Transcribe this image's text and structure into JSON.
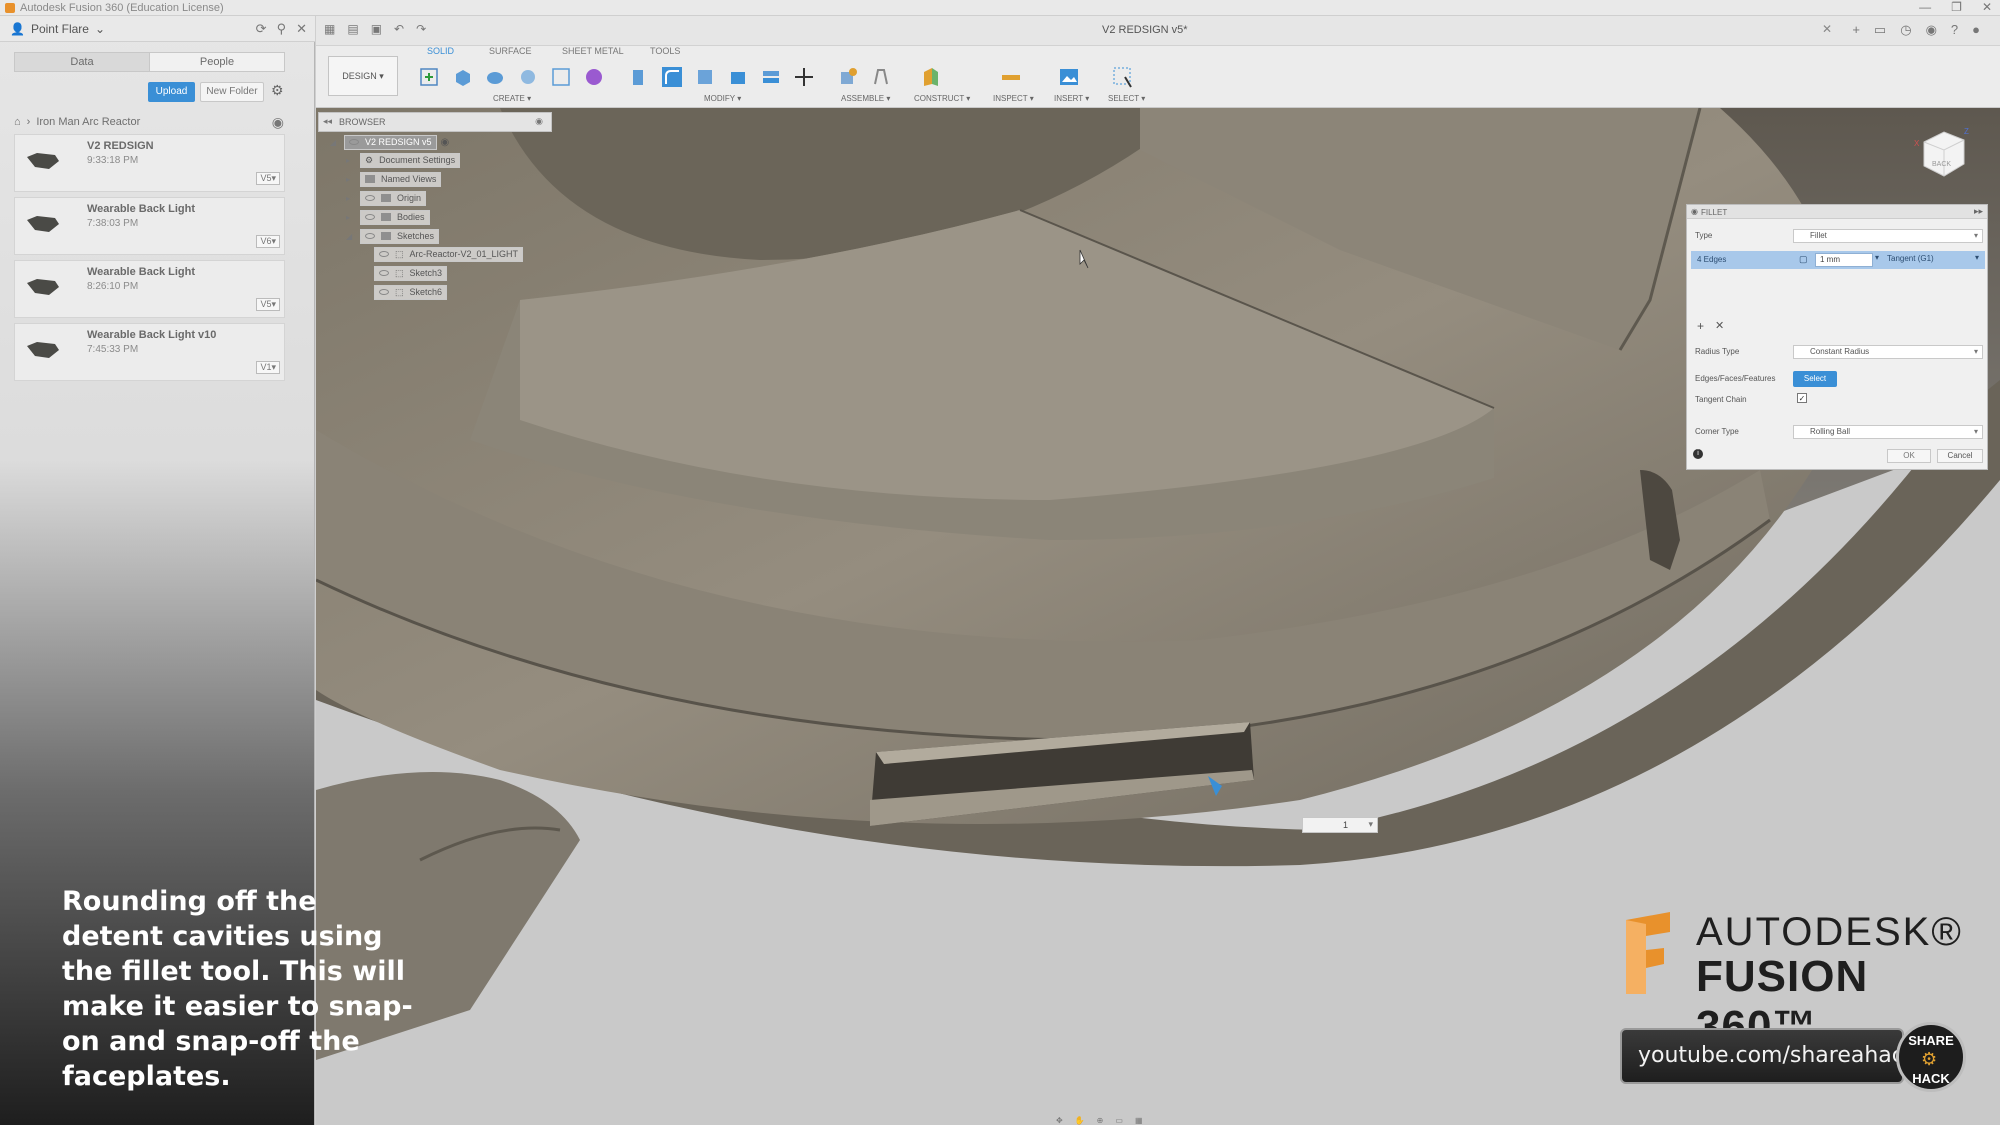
{
  "window": {
    "title": "Autodesk Fusion 360 (Education License)",
    "controls": [
      "—",
      "❐",
      "✕"
    ]
  },
  "data_panel": {
    "user": "Point Flare",
    "tabs": [
      {
        "label": "Data",
        "active": true
      },
      {
        "label": "People",
        "active": false
      }
    ],
    "upload_label": "Upload",
    "new_folder_label": "New Folder",
    "breadcrumb": "Iron Man Arc Reactor",
    "files": [
      {
        "name": "V2 REDSIGN",
        "time": "9:33:18 PM",
        "version": "V5▾"
      },
      {
        "name": "Wearable Back Light",
        "time": "7:38:03 PM",
        "version": "V6▾"
      },
      {
        "name": "Wearable Back Light",
        "time": "8:26:10 PM",
        "version": "V5▾"
      },
      {
        "name": "Wearable Back Light v10",
        "time": "7:45:33 PM",
        "version": "V1▾"
      }
    ]
  },
  "toolbar": {
    "doc_title": "V2 REDSIGN v5*",
    "workspace": "DESIGN ▾",
    "tabs": [
      {
        "label": "SOLID",
        "active": true
      },
      {
        "label": "SURFACE",
        "active": false
      },
      {
        "label": "SHEET METAL",
        "active": false
      },
      {
        "label": "TOOLS",
        "active": false
      }
    ],
    "groups": [
      "CREATE ▾",
      "MODIFY ▾",
      "ASSEMBLE ▾",
      "CONSTRUCT ▾",
      "INSPECT ▾",
      "INSERT ▾",
      "SELECT ▾"
    ]
  },
  "browser": {
    "title": "BROWSER",
    "root": "V2 REDSIGN v5",
    "nodes": [
      "Document Settings",
      "Named Views",
      "Origin",
      "Bodies",
      "Sketches"
    ],
    "sketches": [
      "Arc-Reactor-V2_01_LIGHT",
      "Sketch3",
      "Sketch6"
    ]
  },
  "viewcube": {
    "label": "BACK"
  },
  "fillet": {
    "title": "FILLET",
    "type_label": "Type",
    "type_value": "Fillet",
    "selection_label": "4 Edges",
    "radius_value": "1 mm",
    "continuity": "Tangent (G1)",
    "radius_type_label": "Radius Type",
    "radius_type_value": "Constant Radius",
    "edges_label": "Edges/Faces/Features",
    "select_label": "Select",
    "tangent_chain_label": "Tangent Chain",
    "tangent_chain_checked": true,
    "corner_type_label": "Corner Type",
    "corner_type_value": "Rolling Ball",
    "ok_label": "OK",
    "cancel_label": "Cancel"
  },
  "canvas_input": {
    "value": "1",
    "dropdown": "▾"
  },
  "caption": "Rounding off the detent cavities using the fillet tool. This will make it easier to snap-on and snap-off the faceplates.",
  "brand": {
    "line1": "AUTODESK®",
    "line2": "FUSION 360™",
    "youtube": "youtube.com/shareahack",
    "badge_top": "SHARE",
    "badge_bottom": "HACK"
  },
  "colors": {
    "accent": "#3a8fd6",
    "model": "#8a8273",
    "brand_orange": "#e8912c"
  }
}
